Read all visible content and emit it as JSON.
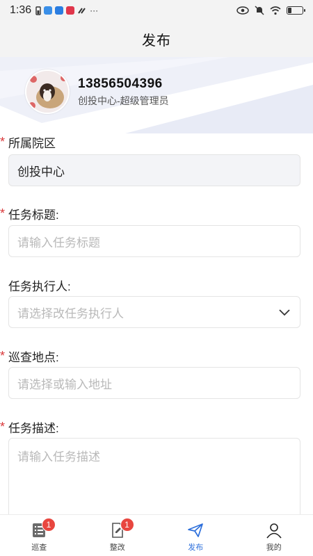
{
  "status_bar": {
    "time": "1:36",
    "more": "···",
    "battery_level": 0.25
  },
  "header": {
    "title": "发布"
  },
  "profile": {
    "phone": "13856504396",
    "role": "创投中心-超级管理员"
  },
  "form": {
    "campus": {
      "label": "所属院区",
      "required": true,
      "value": "创投中心"
    },
    "task_title": {
      "label": "任务标题:",
      "required": true,
      "placeholder": "请输入任务标题"
    },
    "executor": {
      "label": "任务执行人:",
      "required": false,
      "placeholder": "请选择改任务执行人"
    },
    "location": {
      "label": "巡查地点:",
      "required": true,
      "placeholder": "请选择或输入地址"
    },
    "description": {
      "label": "任务描述:",
      "required": true,
      "placeholder": "请输入任务描述"
    },
    "required_mark": "*"
  },
  "tabbar": {
    "tabs": [
      {
        "label": "巡查",
        "icon": "list-doc-icon",
        "badge": "1",
        "active": false
      },
      {
        "label": "整改",
        "icon": "edit-doc-icon",
        "badge": "1",
        "active": false
      },
      {
        "label": "发布",
        "icon": "send-icon",
        "badge": "",
        "active": true
      },
      {
        "label": "我的",
        "icon": "user-icon",
        "badge": "",
        "active": false
      }
    ]
  },
  "colors": {
    "accent": "#2d6fdb",
    "required": "#d9383a",
    "badge": "#e8463f",
    "header_bg": "#f3f3f3"
  }
}
